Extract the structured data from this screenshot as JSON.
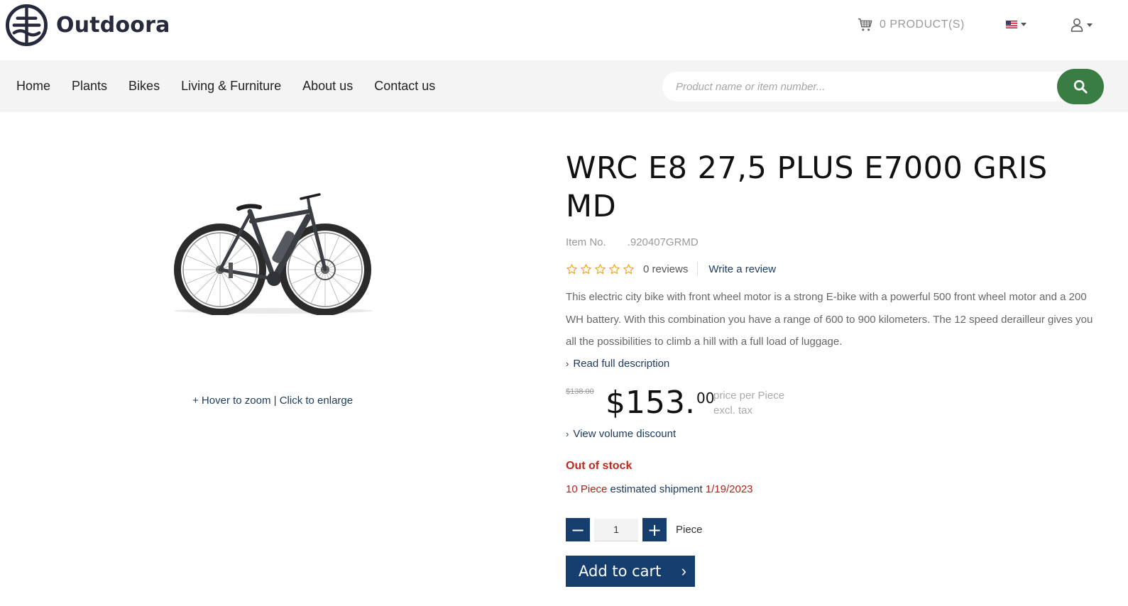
{
  "brand": {
    "name": "Outdoora"
  },
  "header": {
    "cart_label": "0 PRODUCT(S)",
    "cart_icon": "cart-icon",
    "language_icon": "us-flag-icon",
    "account_icon": "user-icon"
  },
  "nav": {
    "items": [
      "Home",
      "Plants",
      "Bikes",
      "Living & Furniture",
      "About us",
      "Contact us"
    ]
  },
  "search": {
    "placeholder": "Product name or item number...",
    "button_icon": "search-icon",
    "button_color": "#3a7d44"
  },
  "gallery": {
    "zoom_hint": "+ Hover to zoom",
    "separator": " | ",
    "enlarge_hint": "Click to enlarge"
  },
  "product": {
    "title": "WRC E8 27,5 PLUS E7000 GRIS MD",
    "item_no_label": "Item No.",
    "item_no_value": ".920407GRMD",
    "rating": 0,
    "reviews_count": "0 reviews",
    "write_review": "Write a review",
    "description": "This electric city bike with front wheel motor is a strong E-bike with a powerful 500 front wheel motor and a 200 WH battery. With this combination you have a range of 600 to 900 kilometers. The 12 speed derailleur gives you all the possibilities to climb a hill with a full load of luggage.",
    "read_more": "Read full description",
    "old_price": "$138.00",
    "price_main": "$153.",
    "price_cents": "00",
    "price_note_1": "price per Piece",
    "price_note_2": "excl. tax",
    "volume_discount": "View volume discount",
    "stock_status": "Out of stock",
    "shipment_qty": "10 Piece",
    "shipment_text": " estimated shipment ",
    "shipment_date": "1/19/2023",
    "quantity": "1",
    "unit": "Piece",
    "add_to_cart": "Add to cart",
    "add_arrow": "›",
    "minus_symbol": "−",
    "plus_symbol": "+"
  },
  "colors": {
    "primary_blue": "#153d6e",
    "out_of_stock_red": "#c0271f",
    "star_gold": "#f2a900",
    "nav_bg": "#f4f4f4"
  }
}
